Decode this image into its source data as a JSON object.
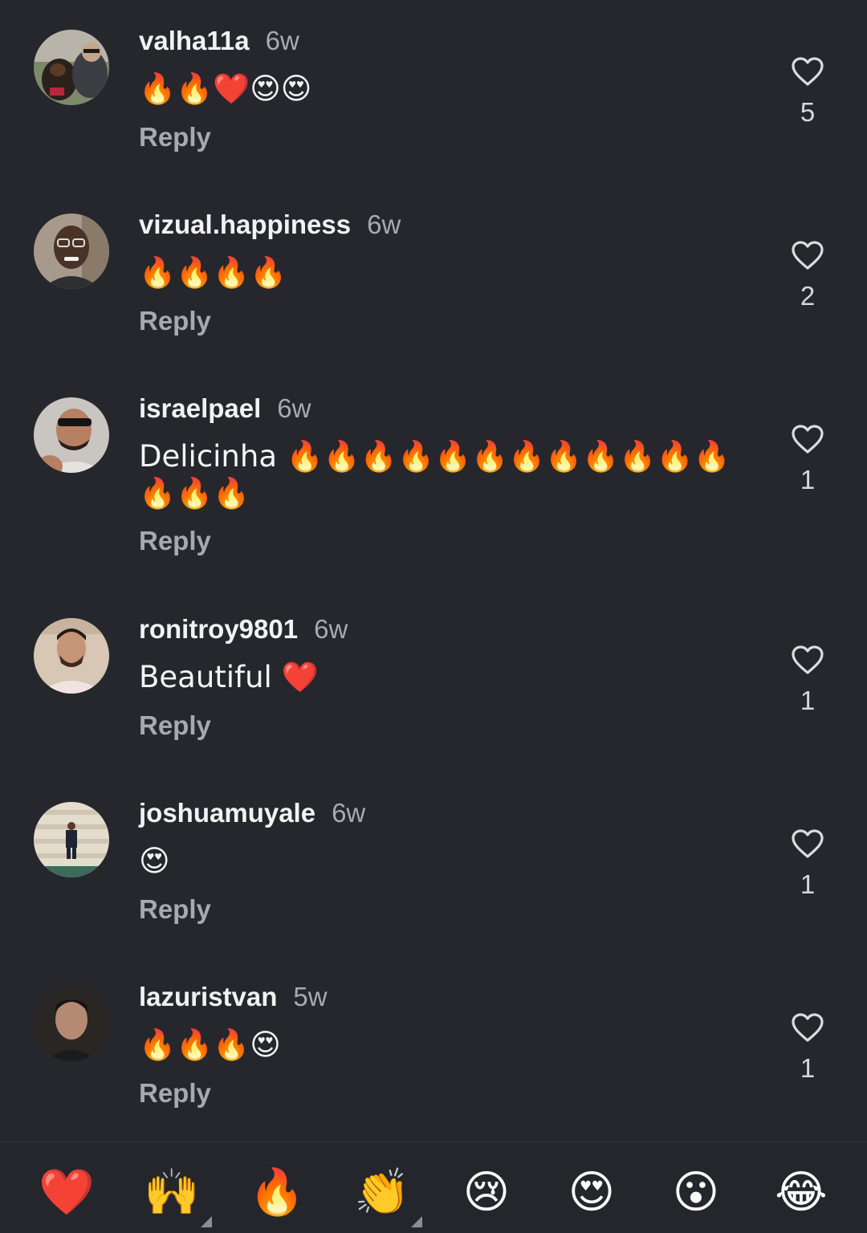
{
  "comments": [
    {
      "username": "valha11a",
      "time": "6w",
      "text": "🔥🔥❤️😍😍",
      "reply": "Reply",
      "likes": "5",
      "avatar": "dog-photo"
    },
    {
      "username": "vizual.happiness",
      "time": "6w",
      "text": "🔥🔥🔥🔥",
      "reply": "Reply",
      "likes": "2",
      "avatar": "man-glasses-photo"
    },
    {
      "username": "israelpael",
      "time": "6w",
      "text": "Delicinha 🔥🔥🔥🔥🔥🔥🔥🔥🔥🔥🔥🔥🔥🔥🔥",
      "reply": "Reply",
      "likes": "1",
      "avatar": "man-sunglasses-photo"
    },
    {
      "username": "ronitroy9801",
      "time": "6w",
      "text": "Beautiful ❤️",
      "reply": "Reply",
      "likes": "1",
      "avatar": "man-beard-photo"
    },
    {
      "username": "joshuamuyale",
      "time": "6w",
      "text": "😍",
      "reply": "Reply",
      "likes": "1",
      "avatar": "man-on-steps-photo"
    },
    {
      "username": "lazuristvan",
      "time": "5w",
      "text": "🔥🔥🔥😍",
      "reply": "Reply",
      "likes": "1",
      "avatar": "man-portrait-photo"
    }
  ],
  "emoji_tray": [
    {
      "emoji": "❤️",
      "name": "heart",
      "has_variants": false
    },
    {
      "emoji": "🙌",
      "name": "raising-hands",
      "has_variants": true
    },
    {
      "emoji": "🔥",
      "name": "fire",
      "has_variants": false
    },
    {
      "emoji": "👏",
      "name": "clapping-hands",
      "has_variants": true
    },
    {
      "emoji": "😢",
      "name": "crying-face",
      "has_variants": false
    },
    {
      "emoji": "😍",
      "name": "heart-eyes",
      "has_variants": false
    },
    {
      "emoji": "😮",
      "name": "surprised-face",
      "has_variants": false
    },
    {
      "emoji": "😂",
      "name": "tears-of-joy",
      "has_variants": false
    }
  ],
  "colors": {
    "background": "#26272d",
    "username": "#f2f2f2",
    "muted": "#a9aab0",
    "heart_outline": "#dcdce0"
  }
}
